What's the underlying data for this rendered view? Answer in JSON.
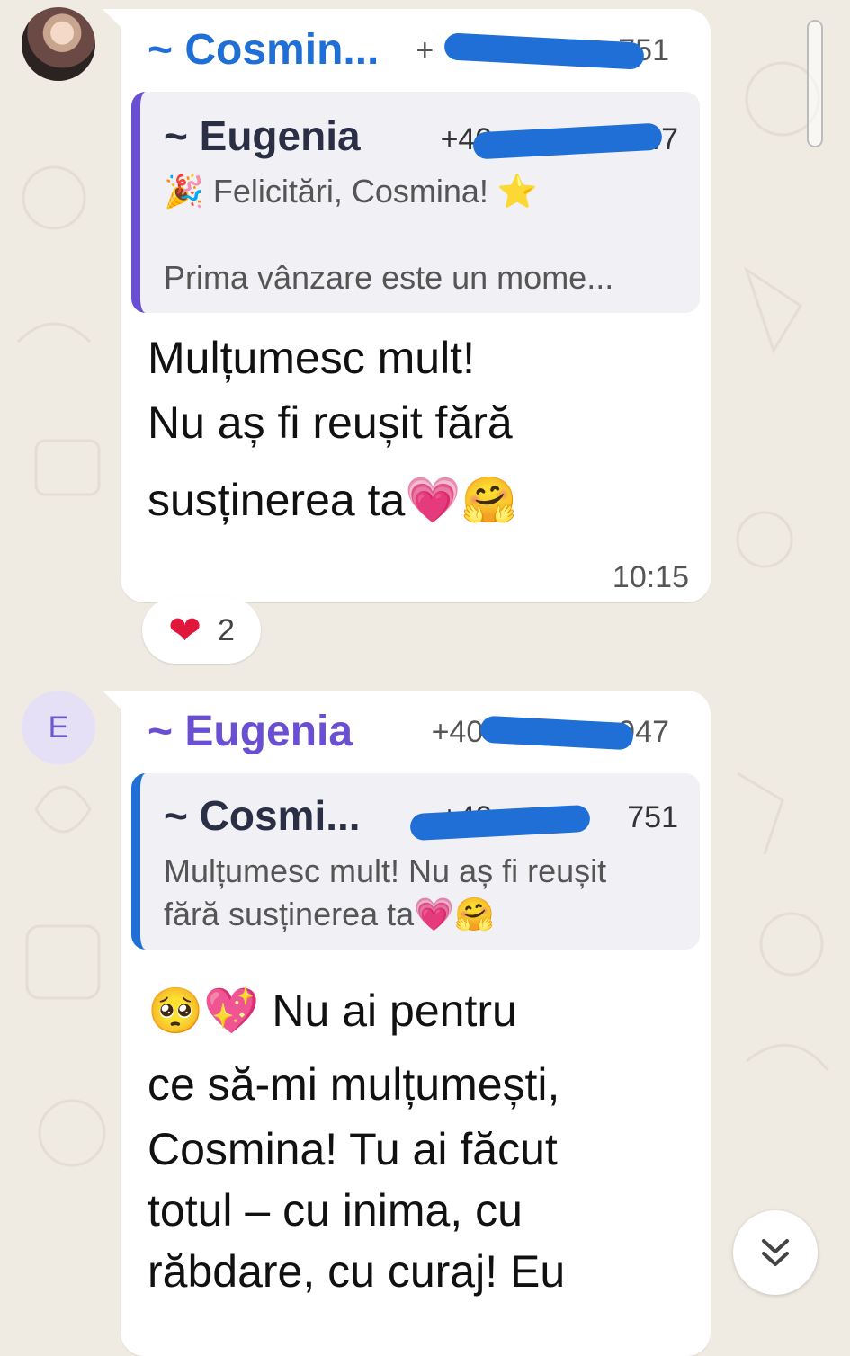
{
  "colors": {
    "background": "#efeae2",
    "bubble": "#ffffff",
    "cosmina_name": "#1f6fd6",
    "eugenia_name": "#6a4fd2",
    "redaction": "#1f6fd6",
    "reaction_heart": "#e0163a"
  },
  "messages": [
    {
      "avatar_icon": "profile-photo",
      "sender": "~ Cosmin...",
      "phone_visible": "+",
      "phone_visible_end": "751",
      "quote": {
        "name": "~ Eugenia",
        "phone_visible": "+40",
        "phone_visible_end": "947",
        "line1": "🎉 Felicitări, Cosmina! ⭐",
        "line2": "Prima vânzare este un mome..."
      },
      "text_lines": [
        "Mulțumesc mult!",
        "Nu aș fi reușit fără",
        "susținerea ta💗🤗"
      ],
      "time": "10:15",
      "reaction": {
        "emoji": "❤",
        "count": "2"
      }
    },
    {
      "avatar_letter": "E",
      "sender": "~ Eugenia",
      "phone_visible": "+40",
      "phone_visible_end": "947",
      "quote": {
        "name": "~ Cosmi...",
        "phone_visible": "+40",
        "phone_visible_end": "751",
        "line1": "Mulțumesc mult! Nu aș fi reușit",
        "line2": "fără susținerea ta💗🤗"
      },
      "text_lines": [
        "🥺💖 Nu ai pentru",
        "ce să-mi mulțumești,",
        "Cosmina! Tu ai făcut",
        "totul – cu inima, cu",
        "răbdare, cu curaj! Eu"
      ]
    }
  ],
  "scroll_button": {
    "icon": "double-chevron-down-icon"
  }
}
